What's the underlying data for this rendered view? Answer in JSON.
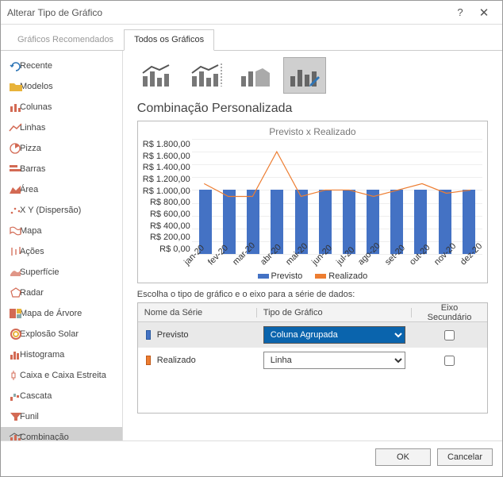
{
  "window": {
    "title": "Alterar Tipo de Gráfico"
  },
  "tabs": {
    "recommended": "Gráficos Recomendados",
    "all": "Todos os Gráficos"
  },
  "sidebar": {
    "items": [
      {
        "label": "Recente"
      },
      {
        "label": "Modelos"
      },
      {
        "label": "Colunas"
      },
      {
        "label": "Linhas"
      },
      {
        "label": "Pizza"
      },
      {
        "label": "Barras"
      },
      {
        "label": "Área"
      },
      {
        "label": "X Y (Dispersão)"
      },
      {
        "label": "Mapa"
      },
      {
        "label": "Ações"
      },
      {
        "label": "Superfície"
      },
      {
        "label": "Radar"
      },
      {
        "label": "Mapa de Árvore"
      },
      {
        "label": "Explosão Solar"
      },
      {
        "label": "Histograma"
      },
      {
        "label": "Caixa e Caixa Estreita"
      },
      {
        "label": "Cascata"
      },
      {
        "label": "Funil"
      },
      {
        "label": "Combinação"
      }
    ]
  },
  "main": {
    "section_title": "Combinação Personalizada",
    "instruction": "Escolha o tipo de gráfico e o eixo para a série de dados:",
    "table": {
      "col_series": "Nome da Série",
      "col_type": "Tipo de Gráfico",
      "col_secondary": "Eixo Secundário",
      "rows": [
        {
          "name": "Previsto",
          "type": "Coluna Agrupada",
          "color": "#4472c4",
          "selected": true,
          "highlight": true,
          "secondary": false
        },
        {
          "name": "Realizado",
          "type": "Linha",
          "color": "#ed7d31",
          "selected": false,
          "highlight": false,
          "secondary": false
        }
      ]
    }
  },
  "chart_data": {
    "type": "combo",
    "title": "Previsto x Realizado",
    "categories": [
      "jan-20",
      "fev-20",
      "mar-20",
      "abr-20",
      "mai-20",
      "jun-20",
      "jul-20",
      "ago-20",
      "set-20",
      "out-20",
      "nov-20",
      "dez-20"
    ],
    "series": [
      {
        "name": "Previsto",
        "type": "bar",
        "color": "#4472c4",
        "values": [
          1000,
          1000,
          1000,
          1000,
          1000,
          1000,
          1000,
          1000,
          1000,
          1000,
          1000,
          1000
        ]
      },
      {
        "name": "Realizado",
        "type": "line",
        "color": "#ed7d31",
        "values": [
          1100,
          900,
          900,
          1600,
          900,
          1000,
          1000,
          900,
          1000,
          1100,
          950,
          1000
        ]
      }
    ],
    "ylabel": "",
    "xlabel": "",
    "y_ticks": [
      "R$ 1.800,00",
      "R$ 1.600,00",
      "R$ 1.400,00",
      "R$ 1.200,00",
      "R$ 1.000,00",
      "R$ 800,00",
      "R$ 600,00",
      "R$ 400,00",
      "R$ 200,00",
      "R$ 0,00"
    ],
    "ylim": [
      0,
      1800
    ],
    "legend": [
      "Previsto",
      "Realizado"
    ]
  },
  "footer": {
    "ok": "OK",
    "cancel": "Cancelar"
  }
}
